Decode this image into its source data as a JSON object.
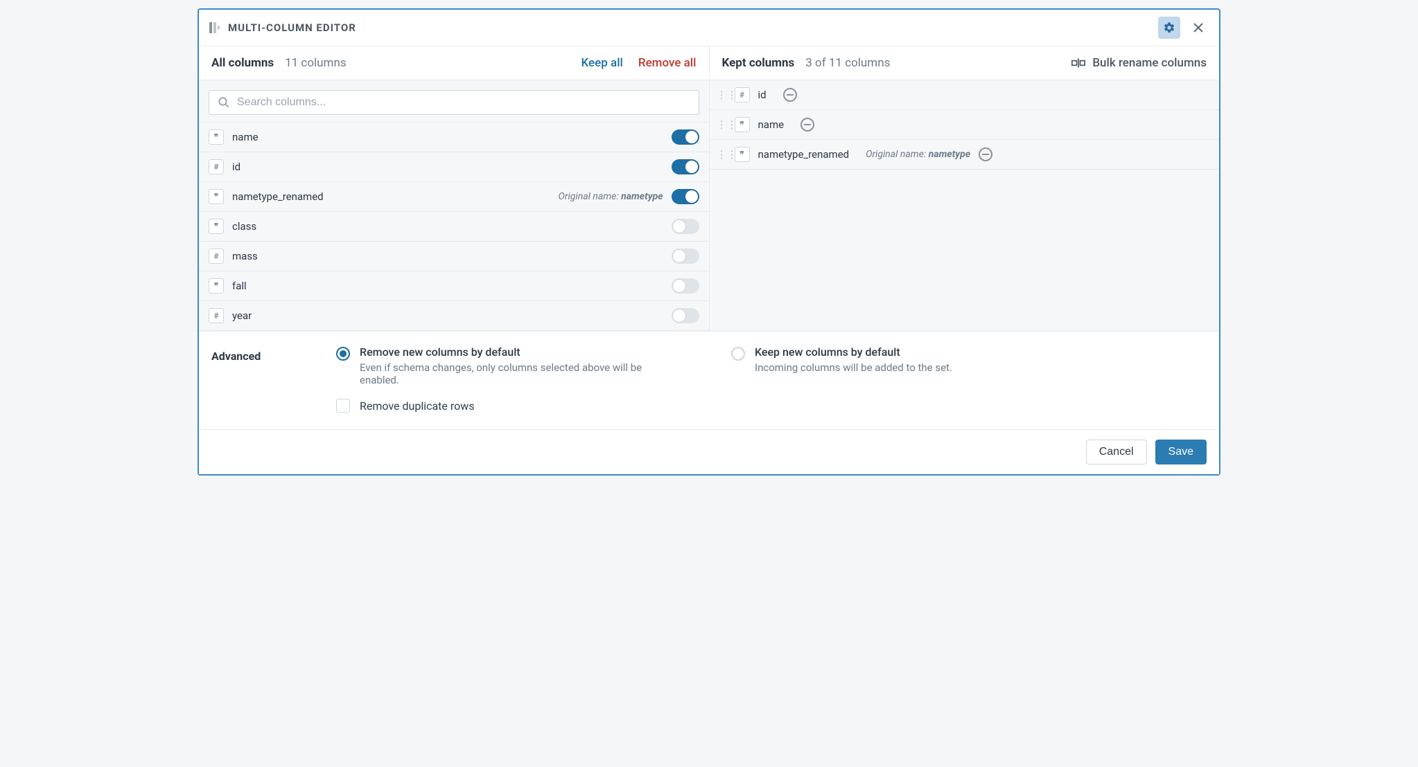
{
  "header": {
    "title": "MULTI-COLUMN EDITOR"
  },
  "left": {
    "title": "All columns",
    "count_text": "11 columns",
    "keep_all": "Keep all",
    "remove_all": "Remove all",
    "search_placeholder": "Search columns...",
    "columns": [
      {
        "type": "str",
        "name": "name",
        "on": true
      },
      {
        "type": "num",
        "name": "id",
        "on": true
      },
      {
        "type": "str",
        "name": "nametype_renamed",
        "on": true,
        "original": "nametype"
      },
      {
        "type": "str",
        "name": "class",
        "on": false
      },
      {
        "type": "num",
        "name": "mass",
        "on": false
      },
      {
        "type": "str",
        "name": "fall",
        "on": false
      },
      {
        "type": "num",
        "name": "year",
        "on": false
      }
    ]
  },
  "right": {
    "title": "Kept columns",
    "count_text": "3 of 11 columns",
    "bulk_rename": "Bulk rename columns",
    "original_prefix": "Original name:",
    "kept": [
      {
        "type": "num",
        "name": "id"
      },
      {
        "type": "str",
        "name": "name"
      },
      {
        "type": "str",
        "name": "nametype_renamed",
        "original": "nametype"
      }
    ]
  },
  "advanced": {
    "label": "Advanced",
    "opt1_title": "Remove new columns by default",
    "opt1_desc": "Even if schema changes, only columns selected above will be enabled.",
    "opt2_title": "Keep new columns by default",
    "opt2_desc": "Incoming columns will be added to the set.",
    "dup_label": "Remove duplicate rows"
  },
  "footer": {
    "cancel": "Cancel",
    "save": "Save"
  },
  "type_glyph": {
    "str": "❞",
    "num": "#"
  }
}
